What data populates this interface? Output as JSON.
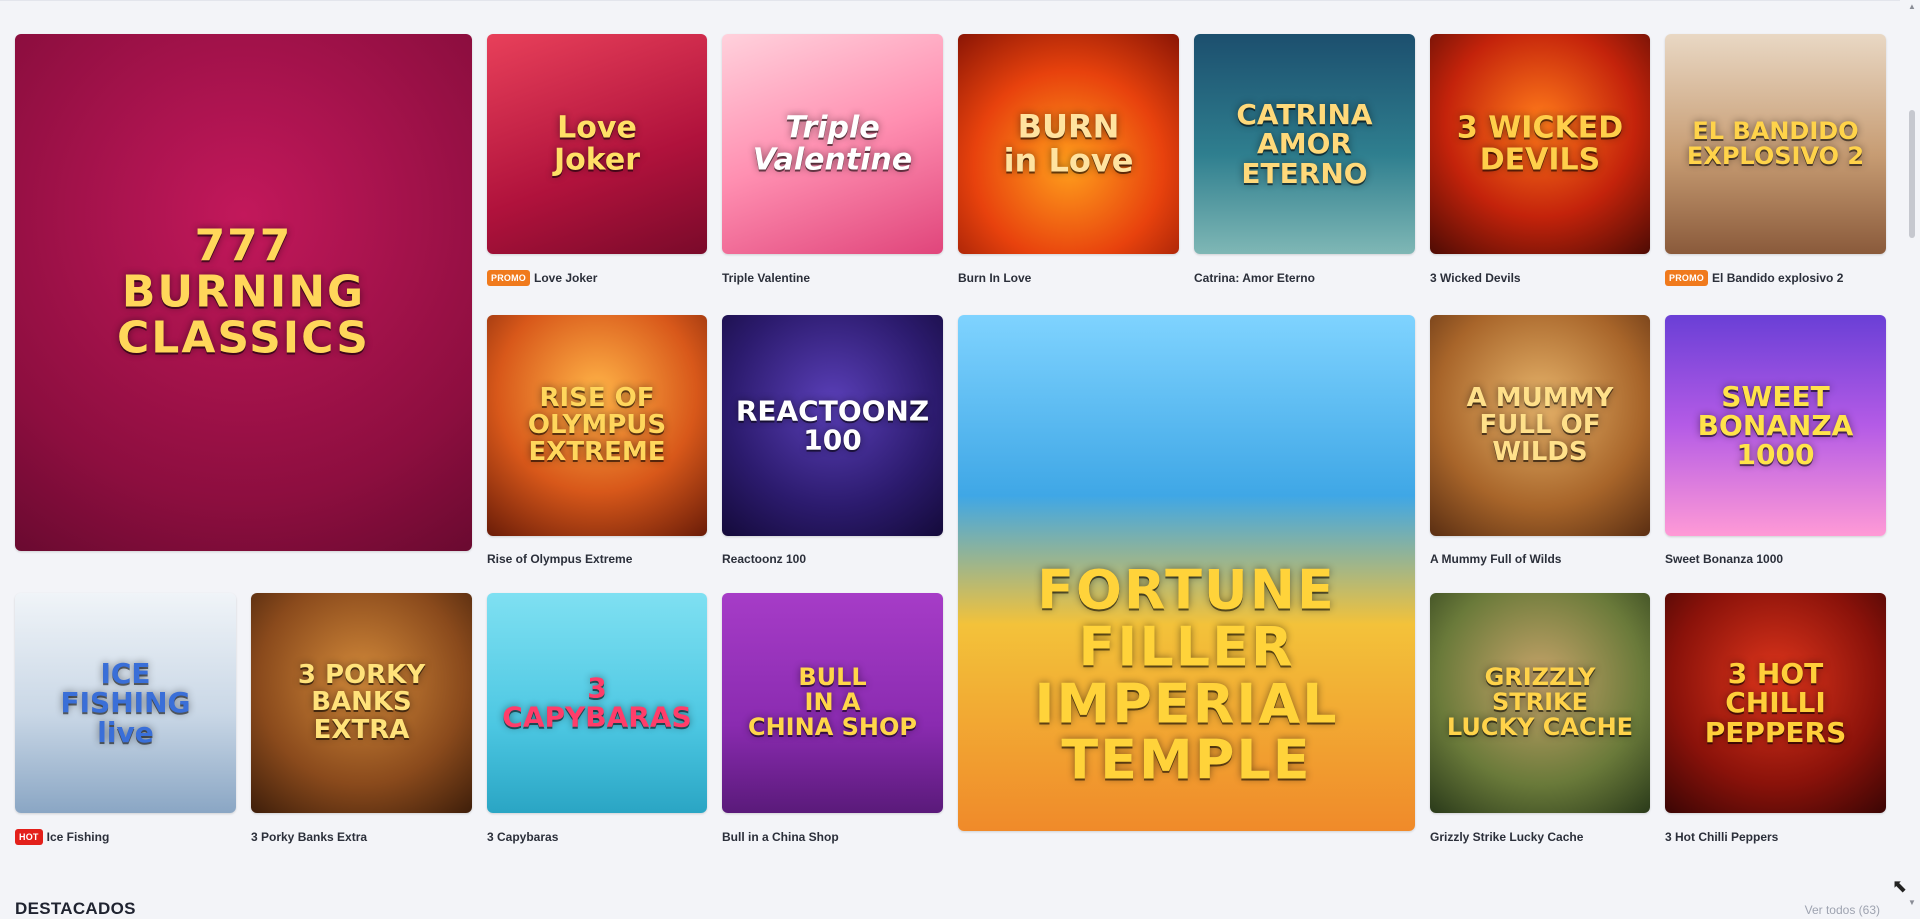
{
  "games": {
    "burning_classics": {
      "title": "Burning Classics",
      "art": "777\nBURNING CLASSICS"
    },
    "love_joker": {
      "title": "Love Joker",
      "badge": "PROMO",
      "art": "Love\nJoker"
    },
    "triple_valentine": {
      "title": "Triple Valentine",
      "art": "Triple\nValentine"
    },
    "burn_in_love": {
      "title": "Burn In Love",
      "art": "BURN\nin Love"
    },
    "catrina": {
      "title": "Catrina: Amor Eterno",
      "art": "CATRINA\nAMOR ETERNO"
    },
    "wicked_devils": {
      "title": "3 Wicked Devils",
      "art": "3 WICKED\nDEVILS"
    },
    "bandido": {
      "title": "El Bandido explosivo 2",
      "badge": "PROMO",
      "art": "EL BANDIDO\nEXPLOSIVO 2"
    },
    "rise_olympus": {
      "title": "Rise of Olympus Extreme",
      "art": "RISE OF\nOLYMPUS\nEXTREME"
    },
    "reactoonz": {
      "title": "Reactoonz 100",
      "art": "REACTOONZ\n100"
    },
    "fortune_filler": {
      "title": "Fortune Filler Imperial Temple",
      "art": "FORTUNE\nFILLER\nIMPERIAL TEMPLE"
    },
    "mummy": {
      "title": "A Mummy Full of Wilds",
      "art": "A MUMMY\nFULL OF\nWILDS"
    },
    "sweet_bonanza": {
      "title": "Sweet Bonanza 1000",
      "art": "SWEET\nBONANZA\n1000"
    },
    "ice_fishing": {
      "title": "Ice Fishing",
      "badge": "HOT",
      "art": "ICE\nFISHING\nlive"
    },
    "porky_banks": {
      "title": "3 Porky Banks Extra",
      "art": "3 PORKY\nBANKS\nEXTRA"
    },
    "capybaras": {
      "title": "3 Capybaras",
      "art": "3\nCAPYBARAS"
    },
    "bull_china": {
      "title": "Bull in a China Shop",
      "art": "BULL\nIN A\nCHINA SHOP"
    },
    "grizzly": {
      "title": "Grizzly Strike Lucky Cache",
      "art": "GRIZZLY\nSTRIKE\nLUCKY CACHE"
    },
    "hot_chilli": {
      "title": "3 Hot Chilli Peppers",
      "art": "3 HOT\nCHILLI\nPEPPERS"
    }
  },
  "section": {
    "title": "DESTACADOS",
    "link": "Ver todos (63)"
  },
  "colors": {
    "promo": "#f07a1d",
    "hot": "#e3201b",
    "background": "#f3f4f8"
  }
}
